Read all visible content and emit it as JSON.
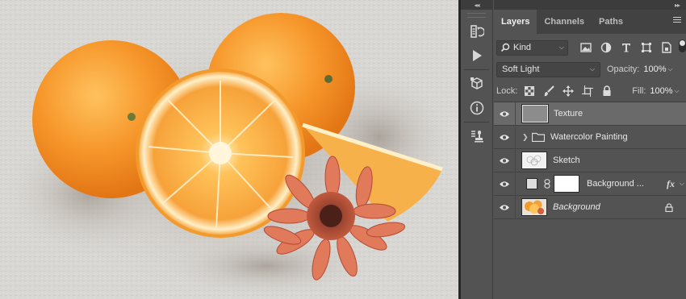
{
  "canvas": {
    "description_icon": "orange-artwork"
  },
  "tool_strip": {
    "collapse_glyph": "◂◂",
    "buttons": [
      {
        "icon": "history-icon"
      },
      {
        "icon": "play-action-icon"
      },
      {
        "icon": "3d-cube-icon"
      },
      {
        "icon": "info-icon"
      },
      {
        "icon": "clone-source-icon"
      }
    ]
  },
  "panel": {
    "collapse_glyph": "▸▸",
    "tabs": [
      {
        "label": "Layers",
        "active": true
      },
      {
        "label": "Channels",
        "active": false
      },
      {
        "label": "Paths",
        "active": false
      }
    ],
    "filter": {
      "kind_label": "Kind",
      "icons": [
        "image-filter-icon",
        "adjustment-filter-icon",
        "type-filter-icon",
        "shape-filter-icon",
        "smart-object-filter-icon"
      ]
    },
    "blend_mode": "Soft Light",
    "opacity_label": "Opacity:",
    "opacity_value": "100%",
    "lock_label": "Lock:",
    "lock_icons": [
      "lock-transparent-icon",
      "lock-paint-icon",
      "lock-position-icon",
      "lock-artboard-icon",
      "lock-all-icon"
    ],
    "fill_label": "Fill:",
    "fill_value": "100%",
    "layers": [
      {
        "name": "Texture",
        "selected": true,
        "type": "layer"
      },
      {
        "name": "Watercolor Painting",
        "selected": false,
        "type": "group"
      },
      {
        "name": "Sketch",
        "selected": false,
        "type": "layer"
      },
      {
        "name": "Background ...",
        "selected": false,
        "type": "fill-with-mask",
        "fx": "fx"
      },
      {
        "name": "Background",
        "selected": false,
        "type": "background",
        "locked": true
      }
    ]
  },
  "colors": {
    "panel_bg": "#535353",
    "selected_row": "#6a6a6a",
    "accent_orange": "#f39a2c"
  }
}
